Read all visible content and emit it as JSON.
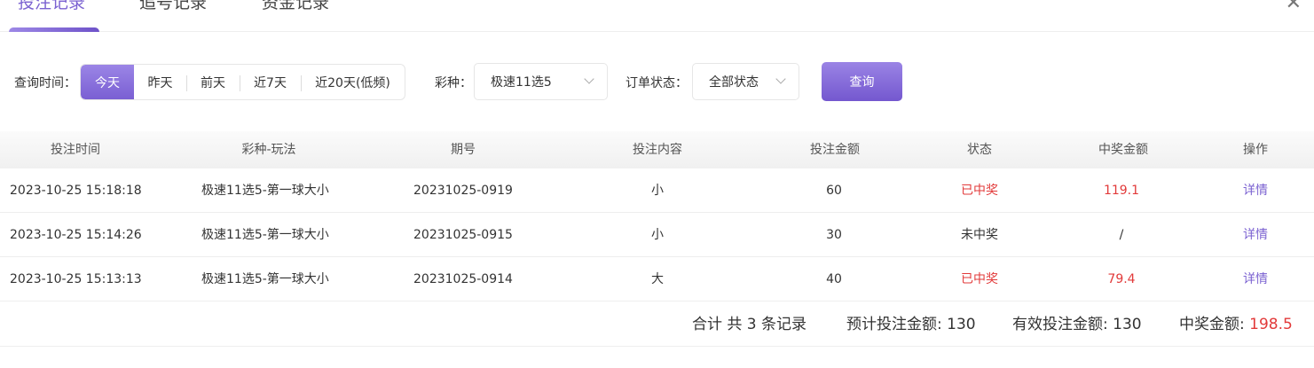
{
  "tabs": [
    {
      "label": "投注记录",
      "active": true
    },
    {
      "label": "追号记录",
      "active": false
    },
    {
      "label": "资金记录",
      "active": false
    }
  ],
  "close_icon": "close-icon",
  "filter": {
    "time_label": "查询时间：",
    "time_options": [
      "今天",
      "昨天",
      "前天",
      "近7天",
      "近20天(低频)"
    ],
    "time_selected": "今天",
    "lottery_label": "彩种：",
    "lottery_value": "极速11选5",
    "status_label": "订单状态：",
    "status_value": "全部状态",
    "query_label": "查询"
  },
  "table": {
    "columns": [
      "投注时间",
      "彩种-玩法",
      "期号",
      "投注内容",
      "投注金额",
      "状态",
      "中奖金额",
      "操作"
    ],
    "rows": [
      {
        "time": "2023-10-25 15:18:18",
        "game": "极速11选5-第一球大小",
        "issue": "20231025-0919",
        "content": "小",
        "amount": "60",
        "status": "已中奖",
        "win": "119.1",
        "action": "详情"
      },
      {
        "time": "2023-10-25 15:14:26",
        "game": "极速11选5-第一球大小",
        "issue": "20231025-0915",
        "content": "小",
        "amount": "30",
        "status": "未中奖",
        "win": "/",
        "action": "详情"
      },
      {
        "time": "2023-10-25 15:13:13",
        "game": "极速11选5-第一球大小",
        "issue": "20231025-0914",
        "content": "大",
        "amount": "40",
        "status": "已中奖",
        "win": "79.4",
        "action": "详情"
      }
    ]
  },
  "summary": {
    "count_text": "合计 共 3 条记录",
    "expected_label": "预计投注金额: ",
    "expected_value": "130",
    "effective_label": "有效投注金额: ",
    "effective_value": "130",
    "win_label": "中奖金额: ",
    "win_value": "198.5"
  },
  "colors": {
    "accent": "#7b62d1",
    "win": "#e23a3a"
  }
}
